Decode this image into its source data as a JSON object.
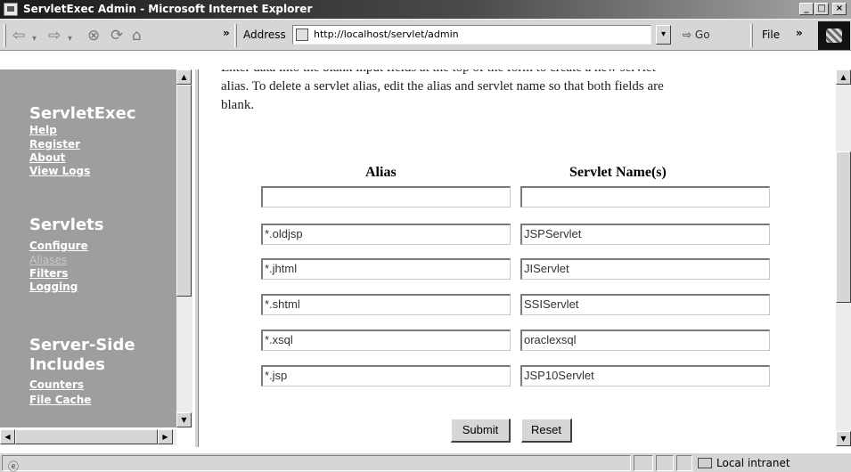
{
  "window": {
    "title": "ServletExec Admin - Microsoft Internet Explorer",
    "min_glyph": "_",
    "max_glyph": "□",
    "close_glyph": "×"
  },
  "toolbar": {
    "back_glyph": "⇦",
    "dropdown_glyph": "▾",
    "forward_glyph": "⇨",
    "stop_glyph": "⊗",
    "refresh_glyph": "⟳",
    "home_glyph": "⌂",
    "chevron": "»",
    "address_label": "Address",
    "url": "http://localhost/servlet/admin",
    "go_label": "Go",
    "go_glyph": "⇨",
    "file_menu": "File"
  },
  "nav": {
    "sections": [
      {
        "heading": "ServletExec",
        "links": [
          "Help",
          "Register",
          "About",
          "View Logs"
        ]
      },
      {
        "heading": "Servlets",
        "links": [
          "Configure",
          "Aliases",
          "Filters",
          "Logging"
        ]
      },
      {
        "heading": "Server-Side",
        "heading2": "Includes",
        "links": [
          "Counters",
          "File Cache"
        ]
      }
    ],
    "current": "Aliases"
  },
  "main": {
    "instructions_line1": "Enter data into the blank input fields at the top of the form to create a new servlet",
    "instructions_line2": "alias. To delete a servlet alias, edit the alias and servlet name so that both fields are",
    "instructions_line3": "blank.",
    "col_alias": "Alias",
    "col_servlet": "Servlet Name(s)",
    "rows": [
      {
        "alias": "",
        "servlet": ""
      },
      {
        "alias": "*.oldjsp",
        "servlet": "JSPServlet"
      },
      {
        "alias": "*.jhtml",
        "servlet": "JIServlet"
      },
      {
        "alias": "*.shtml",
        "servlet": "SSIServlet"
      },
      {
        "alias": "*.xsql",
        "servlet": "oraclexsql"
      },
      {
        "alias": "*.jsp",
        "servlet": "JSP10Servlet"
      }
    ],
    "submit_label": "Submit",
    "reset_label": "Reset"
  },
  "scroll": {
    "up": "▲",
    "down": "▼",
    "left": "◀",
    "right": "▶"
  },
  "status": {
    "icon": "ⓔ",
    "zone": "Local intranet"
  }
}
